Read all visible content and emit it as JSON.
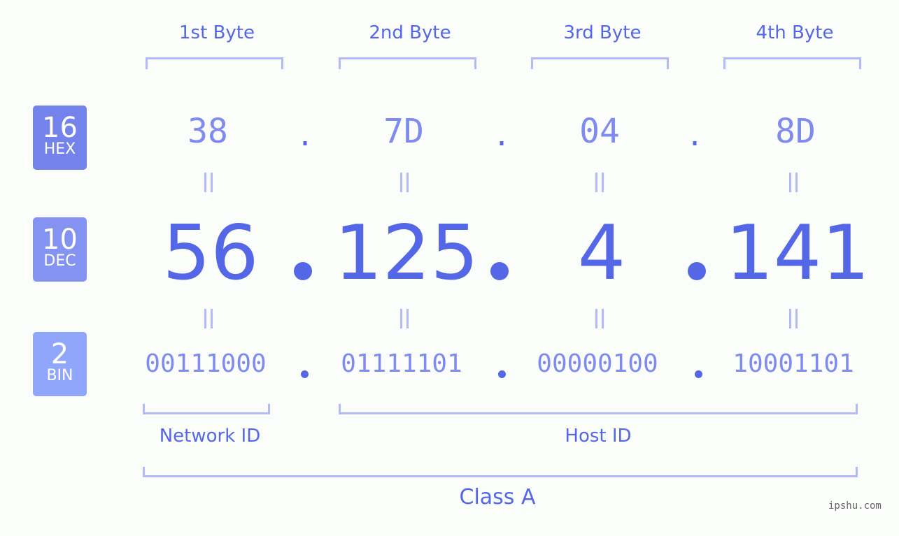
{
  "bytes": [
    {
      "label": "1st Byte",
      "hex": "38",
      "dec": "56",
      "bin": "00111000"
    },
    {
      "label": "2nd Byte",
      "hex": "7D",
      "dec": "125",
      "bin": "01111101"
    },
    {
      "label": "3rd Byte",
      "hex": "04",
      "dec": "4",
      "bin": "00000100"
    },
    {
      "label": "4th Byte",
      "hex": "8D",
      "dec": "141",
      "bin": "10001101"
    }
  ],
  "badges": {
    "hex": {
      "num": "16",
      "label": "HEX",
      "color": "#7482ec"
    },
    "dec": {
      "num": "10",
      "label": "DEC",
      "color": "#8493f1"
    },
    "bin": {
      "num": "2",
      "label": "BIN",
      "color": "#8fa6fa"
    }
  },
  "separator": ".",
  "segments": {
    "network": "Network ID",
    "host": "Host ID",
    "class": "Class A"
  },
  "watermark": "ipshu.com",
  "colors": {
    "accent": "#5467e7",
    "light": "#7f8bee",
    "bracket": "#b2bbf5",
    "background": "#fbfdfb"
  }
}
